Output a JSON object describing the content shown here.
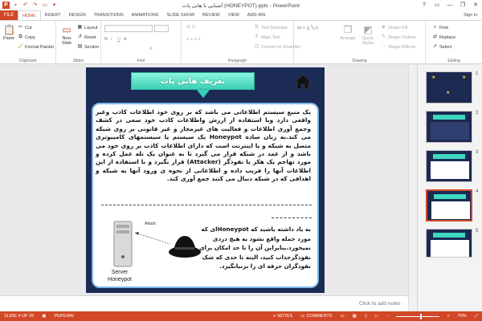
{
  "window": {
    "title": "آشنایی با هانی پات (HONEYPOT).pptx - PowerPoint",
    "help": "?",
    "minimize": "—",
    "restore": "❐",
    "close": "✕"
  },
  "tabs": {
    "file": "FILE",
    "items": [
      "HOME",
      "INSERT",
      "DESIGN",
      "TRANSITIONS",
      "ANIMATIONS",
      "SLIDE SHOW",
      "REVIEW",
      "VIEW",
      "ADD-INS"
    ],
    "active_index": 0,
    "user": "Sign in"
  },
  "ribbon": {
    "clipboard": {
      "label": "Clipboard",
      "paste": "Paste",
      "cut": "Cut",
      "copy": "Copy",
      "format_painter": "Format Painter"
    },
    "slides": {
      "label": "Slides",
      "new_slide": "New Slide",
      "layout": "Layout",
      "reset": "Reset",
      "section": "Section"
    },
    "font": {
      "label": "Font"
    },
    "paragraph": {
      "label": "Paragraph",
      "text_direction": "Text Direction",
      "align_text": "Align Text",
      "convert_smartart": "Convert to SmartArt"
    },
    "drawing": {
      "label": "Drawing",
      "arrange": "Arrange",
      "quick_styles": "Quick Styles",
      "shape_fill": "Shape Fill",
      "shape_outline": "Shape Outline",
      "shape_effects": "Shape Effects"
    },
    "editing": {
      "label": "Editing",
      "find": "Find",
      "replace": "Replace",
      "select": "Select"
    }
  },
  "slide": {
    "title": "تعریف هانی پات",
    "paragraph1_a": "یک منبع سیستم اطلاعاتی می باشد که بر روی خود اطلاعات کاذب وغیر واقعی دارد وبا استفاده از ارزش واطلاعات کاذب خود سعی در کشف وجمع آوری اطلاعات و فعالیت های غیرمجاز و غیر قانونی بر روی شبکه می کند.به زبان ساده",
    "paragraph1_keyword": "Honeypot",
    "paragraph1_b": "یک سیستم یا سیستمهای کامپیوتری متصل به شبکه و یا اینترنت است که دارای اطلاعات کاذب بر روی خود می باشد و از عمد در شبکه قرار می گیرد تا به عنوان یک تله عمل کرده و مورد تهاجم یک هکر یا نفوذگر",
    "paragraph1_attacker": "(Attacker)",
    "paragraph1_c": "قرار بگیرد و با استفاده از این اطلاعات آنها را فریب داده و اطلاعاتی از نحوه ی ورود آنها به شبکه و اهدافی که در شبکه دنبال می کنند جمع آوری کند.",
    "paragraph2_a": "به یاد داشته باشید که",
    "paragraph2_keyword": "Honeypot",
    "paragraph2_b": "ای که مورد حمله واقع نشود به هیچ دردی نمیخورد.بنابراین آن را تا حد امکان برای نفوذگرجذاب کنید، البته تا حدی که شک نفوذگران حرفه ای را برنیانگیزد.",
    "server_label": "Server Honeypot",
    "attack_label": "Attack"
  },
  "thumbnails": [
    {
      "number": "1"
    },
    {
      "number": "2"
    },
    {
      "number": "3"
    },
    {
      "number": "4"
    },
    {
      "number": "5"
    }
  ],
  "notes_placeholder": "Click to add notes",
  "statusbar": {
    "slide_info": "SLIDE 4 OF 26",
    "language": "PERSIAN",
    "notes": "NOTES",
    "comments": "COMMENTS",
    "zoom": "70%"
  },
  "colors": {
    "accent": "#d24726",
    "slide_bg": "#1b2b55",
    "title_box": "#3cd0b6"
  }
}
